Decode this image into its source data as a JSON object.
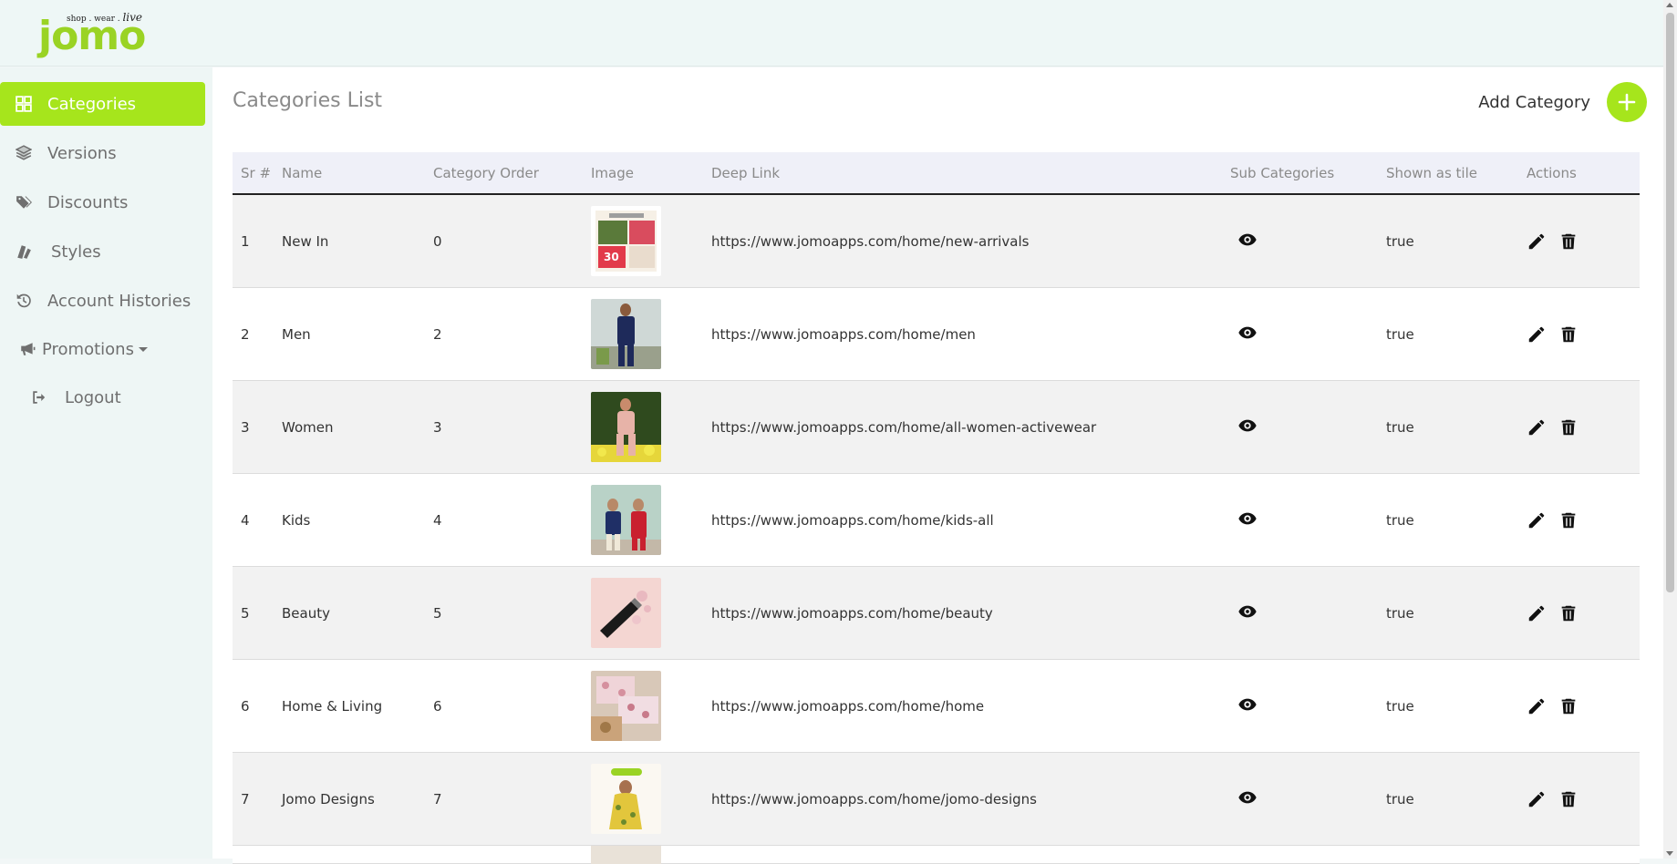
{
  "brand": {
    "name": "jomo",
    "tagline": "shop . wear . ",
    "tagline_script": "live",
    "color": "#9ad324"
  },
  "sidebar": {
    "items": [
      {
        "label": "Categories",
        "icon": "grid-icon",
        "active": true
      },
      {
        "label": "Versions",
        "icon": "layers-icon"
      },
      {
        "label": "Discounts",
        "icon": "tags-icon"
      },
      {
        "label": "Styles",
        "icon": "swatch-book-icon"
      },
      {
        "label": "Account Histories",
        "icon": "history-icon"
      },
      {
        "label": "Promotions",
        "icon": "bullhorn-icon",
        "dropdown": true
      },
      {
        "label": "Logout",
        "icon": "sign-out-icon"
      }
    ]
  },
  "main": {
    "title": "Categories List",
    "add_label": "Add Category",
    "accent": "#a6e51c"
  },
  "table": {
    "headers": [
      "Sr #",
      "Name",
      "Category Order",
      "Image",
      "Deep Link",
      "Sub Categories",
      "Shown as tile",
      "Actions"
    ],
    "rows": [
      {
        "sr": "1",
        "name": "New In",
        "order": "0",
        "link": "https://www.jomoapps.com/home/new-arrivals",
        "tile": "true"
      },
      {
        "sr": "2",
        "name": "Men",
        "order": "2",
        "link": "https://www.jomoapps.com/home/men",
        "tile": "true"
      },
      {
        "sr": "3",
        "name": "Women",
        "order": "3",
        "link": "https://www.jomoapps.com/home/all-women-activewear",
        "tile": "true"
      },
      {
        "sr": "4",
        "name": "Kids",
        "order": "4",
        "link": "https://www.jomoapps.com/home/kids-all",
        "tile": "true"
      },
      {
        "sr": "5",
        "name": "Beauty",
        "order": "5",
        "link": "https://www.jomoapps.com/home/beauty",
        "tile": "true"
      },
      {
        "sr": "6",
        "name": "Home & Living",
        "order": "6",
        "link": "https://www.jomoapps.com/home/home",
        "tile": "true"
      },
      {
        "sr": "7",
        "name": "Jomo Designs",
        "order": "7",
        "link": "https://www.jomoapps.com/home/jomo-designs",
        "tile": "true"
      }
    ]
  }
}
